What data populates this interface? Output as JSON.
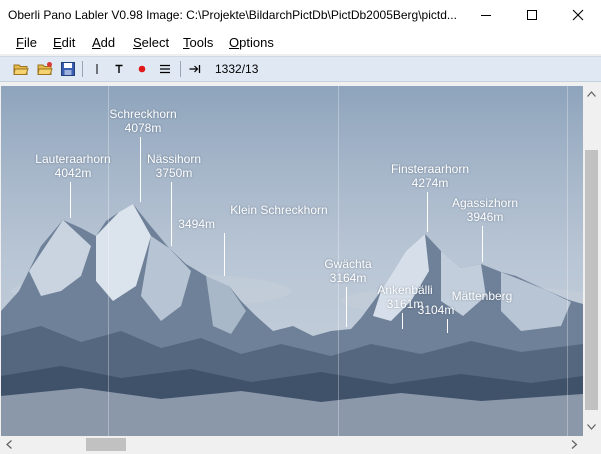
{
  "window": {
    "title": "Oberli Pano Labler V0.98   Image: C:\\Projekte\\BildarchPictDb\\PictDb2005Berg\\pictd..."
  },
  "menu": {
    "file": {
      "key": "F",
      "rest": "ile"
    },
    "edit": {
      "key": "E",
      "rest": "dit"
    },
    "add": {
      "key": "A",
      "rest": "dd"
    },
    "select": {
      "key": "S",
      "rest": "elect"
    },
    "tools": {
      "key": "T",
      "rest": "ools"
    },
    "options": {
      "key": "O",
      "rest": "ptions"
    }
  },
  "toolbar": {
    "counter": "1332/13",
    "icons": [
      "open-folder-icon",
      "open-folder-star-icon",
      "save-icon",
      "line-tool-icon",
      "text-tool-icon",
      "point-tool-icon",
      "list-icon",
      "goto-icon"
    ]
  },
  "labels": [
    {
      "name": "Schreckhorn",
      "height": "4078m"
    },
    {
      "name": "Lauteraarhorn",
      "height": "4042m"
    },
    {
      "name": "Nässihorn",
      "height": "3750m"
    },
    {
      "name": "Klein Schreckhorn",
      "height": "3494m"
    },
    {
      "name": "Finsteraarhorn",
      "height": "4274m"
    },
    {
      "name": "Agassizhorn",
      "height": "3946m"
    },
    {
      "name": "Gwächta",
      "height": "3164m"
    },
    {
      "name": "Ankenbälli",
      "height": "3161m"
    },
    {
      "name": "Mättenberg",
      "height": "3104m"
    }
  ],
  "colors": {
    "toolbar_bg": "#dfe8f3",
    "label_text": "#ffffff",
    "sky": "#b9c6d5",
    "rock": "#6f8199"
  },
  "scroll": {
    "vertical_position": 0.18,
    "horizontal_position": 0.15
  }
}
